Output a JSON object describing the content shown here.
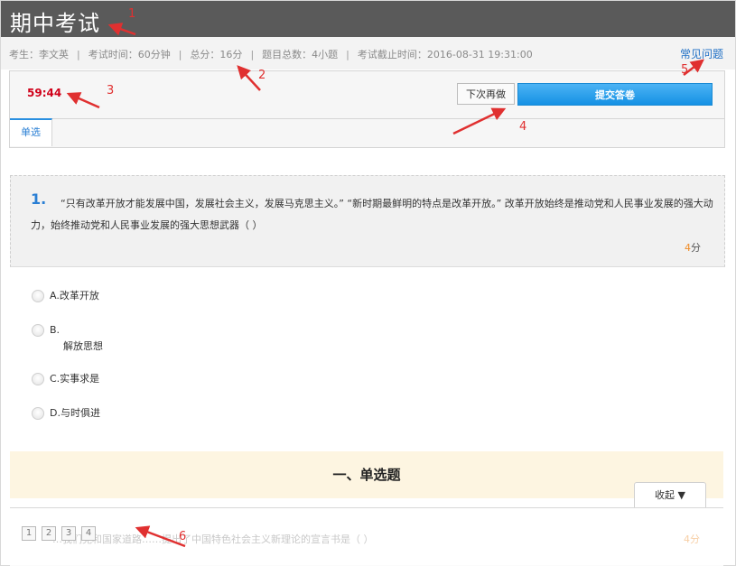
{
  "header": {
    "title": "期中考试"
  },
  "info": {
    "student": "考生：李文英",
    "duration": "考试时间：60分钟",
    "total_score": "总分：16分",
    "question_count": "题目总数：4小题",
    "deadline": "考试截止时间：2016-08-31 19:31:00",
    "separator": "|",
    "faq_label": "常见问题"
  },
  "controls": {
    "timer": "59:44",
    "later_label": "下次再做",
    "submit_label": "提交答卷",
    "tab_label": "单选"
  },
  "question": {
    "number": "1.",
    "text": "“只有改革开放才能发展中国，发展社会主义，发展马克思主义。” “新时期最鲜明的特点是改革开放。” 改革开放始终是推动党和人民事业发展的强大动力，始终推动党和人民事业发展的强大思想武器（ ）",
    "score_value": "4",
    "score_unit": "分",
    "options": [
      {
        "label": "A.改革开放"
      },
      {
        "label": "B.",
        "sub": "解放思想"
      },
      {
        "label": "C.实事求是"
      },
      {
        "label": "D.与时俱进"
      }
    ]
  },
  "section": {
    "title": "一、单选题",
    "collapse_label": "收起 ▼",
    "ghost_question": "…我们党和国家道路……提出了中国特色社会主义新理论的宣言书是（ ）",
    "ghost_score": "4分"
  },
  "question_nav": [
    "1",
    "2",
    "3",
    "4"
  ],
  "annotations": [
    "1",
    "2",
    "3",
    "4",
    "5",
    "6"
  ],
  "colors": {
    "accent": "#2a8fe0",
    "timer": "#d0021b",
    "annotation": "#e03030",
    "score": "#f08c28"
  }
}
